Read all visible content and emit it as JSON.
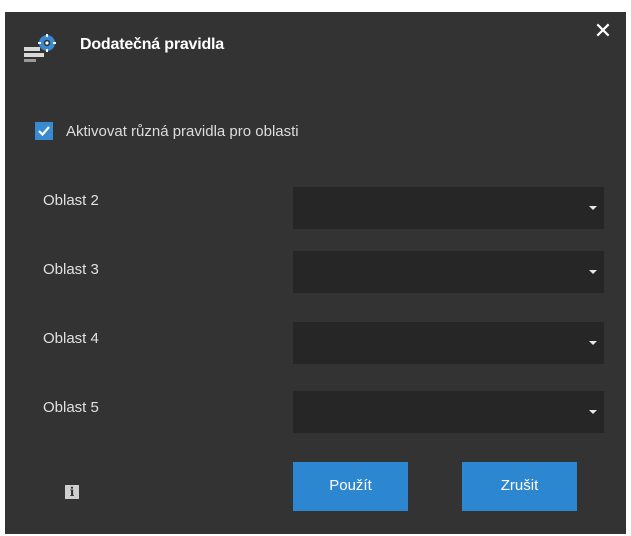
{
  "dialog": {
    "title": "Dodatečná pravidla",
    "title_icon": "settings-rules-icon",
    "close_glyph": "✕"
  },
  "checkbox": {
    "label": "Aktivovat různá pravidla pro oblasti",
    "checked": true
  },
  "areas": [
    {
      "label": "Oblast 2",
      "selected": ""
    },
    {
      "label": "Oblast 3",
      "selected": ""
    },
    {
      "label": "Oblast 4",
      "selected": ""
    },
    {
      "label": "Oblast 5",
      "selected": ""
    }
  ],
  "buttons": {
    "apply_label": "Použít",
    "cancel_label": "Zrušit"
  },
  "info": {
    "glyph": "i"
  },
  "colors": {
    "background": "#333333",
    "select_background": "#262626",
    "accent": "#2d86d0"
  }
}
